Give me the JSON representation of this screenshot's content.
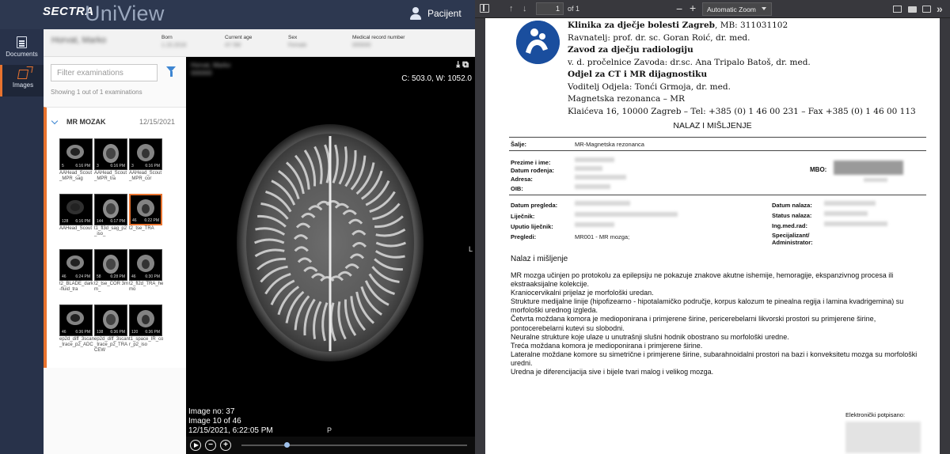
{
  "sectra": {
    "brand_sectra": "SECTRA",
    "brand_uniview": "UniView",
    "user_label": "Pacijent",
    "nav": [
      {
        "label": "Documents",
        "icon": "document-icon"
      },
      {
        "label": "Images",
        "icon": "images-icon",
        "selected": true
      }
    ],
    "patient": {
      "name": "Horvat, Marko",
      "born_label": "Born",
      "born_value": "1.15.2018",
      "age_label": "Current age",
      "age_value": "4Y 5M",
      "sex_label": "Sex",
      "sex_value": "Female",
      "mrn_label": "Medical record number",
      "mrn_value": "000000"
    },
    "filter_placeholder": "Filter examinations",
    "showing_text": "Showing 1 out of 1 examinations",
    "exam": {
      "title": "MR MOZAK",
      "date": "12/15/2021",
      "series": [
        {
          "num": "5",
          "time": "6:16 PM",
          "label": "AAHead_Scout_MPR_sag"
        },
        {
          "num": "3",
          "time": "6:16 PM",
          "label": "AAHead_Scout_MPR_tra"
        },
        {
          "num": "3",
          "time": "6:16 PM",
          "label": "AAHead_Scout_MPR_cor"
        },
        {
          "num": "128",
          "time": "6:16 PM",
          "label": "AAHead_Scout"
        },
        {
          "num": "144",
          "time": "6:17 PM",
          "label": "t1_fl3d_sag_p2_iso_"
        },
        {
          "num": "46",
          "time": "6:22 PM",
          "label": "t2_tse_TRA",
          "selected": true
        },
        {
          "num": "46",
          "time": "6:24 PM",
          "label": "t2_BLADE_dark-fluid_tra"
        },
        {
          "num": "58",
          "time": "6:28 PM",
          "label": "t2_tse_COR 3mm_"
        },
        {
          "num": "46",
          "time": "6:30 PM",
          "label": "t2_fl2d_TRA_hemo"
        },
        {
          "num": "46",
          "time": "6:36 PM",
          "label": "ep2d_diff_3scan_trace_p2_ADC"
        },
        {
          "num": "138",
          "time": "6:36 PM",
          "label": "ep2d_diff_3scan_trace_p2_TRACEW"
        },
        {
          "num": "120",
          "time": "6:36 PM",
          "label": "t1_space_IR_cor_p2_iso"
        }
      ]
    },
    "viewport": {
      "overlay_name": "Horvat, Marko 000000",
      "cw_text": "C: 503.0, W: 1052.0",
      "orient_right": "L",
      "orient_bottom": "P",
      "image_no": "Image no: 37",
      "image_of": "Image 10 of 46",
      "timestamp": "12/15/2021, 6:22:05 PM",
      "slider_fraction": 0.2
    }
  },
  "pdf": {
    "toolbar": {
      "page_value": "1",
      "page_of": "of 1",
      "zoom_label": "Automatic Zoom"
    },
    "letterhead": [
      {
        "text": "Klinika za dječje bolesti Zagreb",
        "suffix": ", MB: 311031102",
        "bold": true
      },
      {
        "text": "Ravnatelj: prof. dr. sc. Goran Roić, dr. med.",
        "bold": false
      },
      {
        "text": "Zavod za dječju radiologiju",
        "bold": true
      },
      {
        "text": "v. d. pročelnice Zavoda: dr.sc. Ana Tripalo Batoš, dr. med.",
        "bold": false
      },
      {
        "text": "Odjel za CT i MR dijagnostiku",
        "bold": true
      },
      {
        "text": "Voditelj Odjela: Tonći Grmoja, dr. med.",
        "bold": false
      },
      {
        "text": "Magnetska rezonanca – MR",
        "bold": false
      },
      {
        "text": "Klaićeva 16, 10000 Zagreb – Tel: +385 (0) 1 46 00 231 – Fax +385 (0) 1 46 00 113",
        "bold": false
      }
    ],
    "doc_title": "NALAZ I MIŠLJENJE",
    "salje_label": "Šalje:",
    "salje_value": "MR-Magnetska rezonanca",
    "patient_labels": [
      "Prezime i ime:",
      "Datum rođenja:",
      "Adresa:",
      "OIB:"
    ],
    "mbo_label": "MBO:",
    "exam_labels_left": [
      "Datum pregleda:",
      "Liječnik:",
      "Uputio liječnik:",
      "Pregledi:"
    ],
    "exam_labels_right": [
      "Datum nalaza:",
      "Status nalaza:",
      "Ing.med.rad:",
      "Specijalizant/ Administrator:"
    ],
    "pregledi_value": "MR001 - MR mozga;",
    "section_heading": "Nalaz i mišljenje",
    "body_lines": [
      "MR mozga učinjen po protokolu za epilepsiju ne pokazuje znakove akutne ishemije, hemoragije, ekspanzivnog procesa ili ekstraaksijalne kolekcije.",
      "Kraniocervikalni prijelaz je morfološki uredan.",
      "Strukture medijalne linije (hipofizearno - hipotalamičko područje, korpus kalozum te pinealna regija i lamina kvadrigemina) su morfološki urednog izgleda.",
      "Četvrta moždana komora je medioponirana i primjerene širine, pericerebelarni likvorski prostori su primjerene širine, pontocerebelarni kutevi su slobodni.",
      "Neuralne strukture koje ulaze u unutrašnji slušni hodnik obostrano su morfološki uredne.",
      "Treća moždana komora je medioponirana i primjerene širine.",
      "Lateralne moždane komore su simetrične i primjerene širine, subarahnoidalni prostori na bazi i konveksitetu mozga su morfološki uredni.",
      "Uredna je diferencijacija sive i bijele tvari malog i velikog mozga."
    ],
    "sign_label": "Elektronički potpisano:"
  }
}
